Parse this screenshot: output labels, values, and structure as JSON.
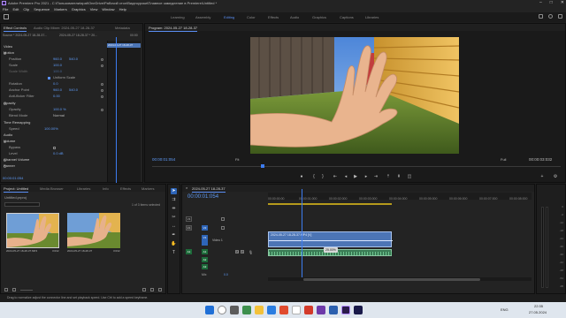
{
  "window": {
    "title": "Adobe Premiere Pro 2021 - C:\\Пользователи\\ираf\\OneDrive\\Рабочий стол\\Видеоуроки\\Плавное замедление в Premiere\\Untitled *",
    "minimize": "–",
    "maximize": "□",
    "close": "✕"
  },
  "menu": [
    "File",
    "Edit",
    "Clip",
    "Sequence",
    "Markers",
    "Graphics",
    "View",
    "Window",
    "Help"
  ],
  "workspaces": {
    "items": [
      "Learning",
      "Assembly",
      "Editing",
      "Color",
      "Effects",
      "Audio",
      "Graphics",
      "Captions",
      "Libraries"
    ],
    "active": "Editing"
  },
  "source_panel": {
    "tabs": [
      "Effect Controls",
      "Audio Clip Mixer: 2024-05-27 18-28-37",
      "Metadata"
    ],
    "source_label": "Source * 2024-05-27 18-28-37...",
    "clip_label": "2024-05-27 18-28-37 * 20...",
    "mini_clip": "2024-05-27 18-28-37",
    "ruler_time": "00:00",
    "video_header": "Video",
    "motion_header": "Motion",
    "rows": [
      {
        "label": "Position",
        "v1": "960.0",
        "v2": "540.0"
      },
      {
        "label": "Scale",
        "v1": "100.0",
        "v2": ""
      },
      {
        "label": "Scale Width",
        "v1": "100.0",
        "v2": ""
      },
      {
        "label": "",
        "v1": "Uniform Scale",
        "v2": ""
      },
      {
        "label": "Rotation",
        "v1": "0.0",
        "v2": ""
      },
      {
        "label": "Anchor Point",
        "v1": "960.0",
        "v2": "540.0"
      },
      {
        "label": "Anti-flicker Filter",
        "v1": "0.00",
        "v2": ""
      }
    ],
    "opacity_header": "Opacity",
    "opacity_rows": [
      {
        "label": "Opacity",
        "v1": "100.0 %"
      },
      {
        "label": "Blend Mode",
        "v1": "Normal"
      }
    ],
    "time_remap_header": "Time Remapping",
    "speed_row": {
      "label": "Speed",
      "v1": "100.00%"
    },
    "audio_header": "Audio",
    "volume_header": "Volume",
    "volume_rows": [
      {
        "label": "Bypass",
        "v1": ""
      },
      {
        "label": "Level",
        "v1": "0.0 dB"
      }
    ],
    "channel_volume": "Channel Volume",
    "panner": "Panner",
    "timecode": "00:00:01:054"
  },
  "program_monitor": {
    "title": "Program: 2024-05-27 18-28-37",
    "timecode_left": "00:00:01:054",
    "fit": "Fit",
    "quality": "Full",
    "timecode_right": "00:00:03:032"
  },
  "project_panel": {
    "tabs": [
      "Project: Untitled",
      "Media Browser",
      "Libraries",
      "Info",
      "Effects",
      "Markers"
    ],
    "file": "Untitled.prproj",
    "selected_info": "1 of 3 items selected",
    "clips": [
      {
        "name": "2024-05-27 18-28-37.MP4",
        "duration": "3:032"
      },
      {
        "name": "2024-05-27 18-28-37",
        "duration": "3:032"
      }
    ]
  },
  "timeline": {
    "title": "2024-05-27 18-28-37",
    "timecode": "00:00:01:054",
    "ruler_times": [
      "00:00",
      "00:00:00:00",
      "00:00:01:000",
      "00:00:02:000",
      "00:00:03:000",
      "00:00:04:000",
      "00:00:05:000",
      "00:00:06:000",
      "00:00:07:000",
      "00:00:08:000"
    ],
    "tracks": [
      "V3",
      "V2",
      "V1",
      "A1",
      "A2",
      "A3",
      "Mix"
    ],
    "video_1": "Video 1",
    "src_v": "V1",
    "src_a": "A1",
    "mix_value": "0.0",
    "clip_label": "2024-05-27 18-28-37.MP4 [V]",
    "speed_badge": "25.00%",
    "meter_labels": [
      "0",
      "-6",
      "-12",
      "-18",
      "-24",
      "-30",
      "-36",
      "-42",
      "-48",
      "-54",
      "dB"
    ]
  },
  "status": {
    "text": "Drag to normalize adjust the connector line and set playback speed. Use Ctrl to add a speed keyframe."
  },
  "taskbar": {
    "lang": "ENG",
    "time": "22:35",
    "date": "27.05.2024"
  },
  "colors": {
    "accent": "#5b8ff5",
    "clip_blue": "#4c75b5",
    "audio_green": "#1d6b3a"
  }
}
